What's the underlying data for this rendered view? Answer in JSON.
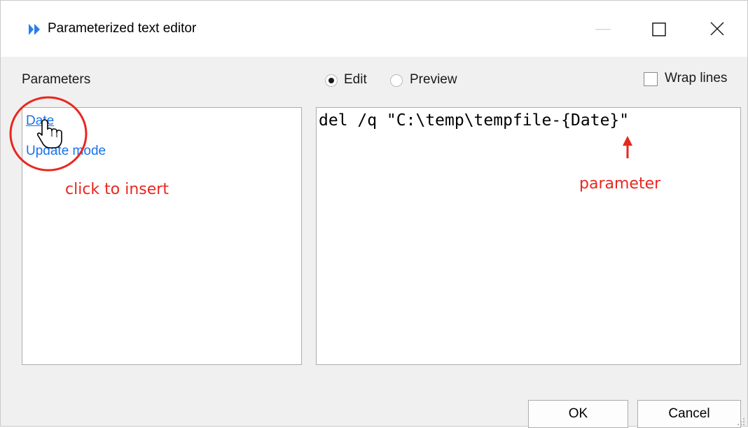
{
  "window": {
    "title": "Parameterized text editor"
  },
  "parameters": {
    "heading": "Parameters",
    "items": [
      {
        "label": "Date"
      },
      {
        "label": "Update mode"
      }
    ]
  },
  "mode": {
    "edit_label": "Edit",
    "preview_label": "Preview",
    "selected": "Edit"
  },
  "wrap_lines": {
    "label": "Wrap lines",
    "checked": false
  },
  "editor": {
    "text": "del /q \"C:\\temp\\tempfile-{Date}\""
  },
  "annotations": {
    "click_hint": "click to insert",
    "parameter_hint": "parameter"
  },
  "buttons": {
    "ok_label": "OK",
    "cancel_label": "Cancel"
  },
  "colors": {
    "link": "#1a73e8",
    "annotation": "#e8271f",
    "app_icon": "#2b7de9"
  }
}
